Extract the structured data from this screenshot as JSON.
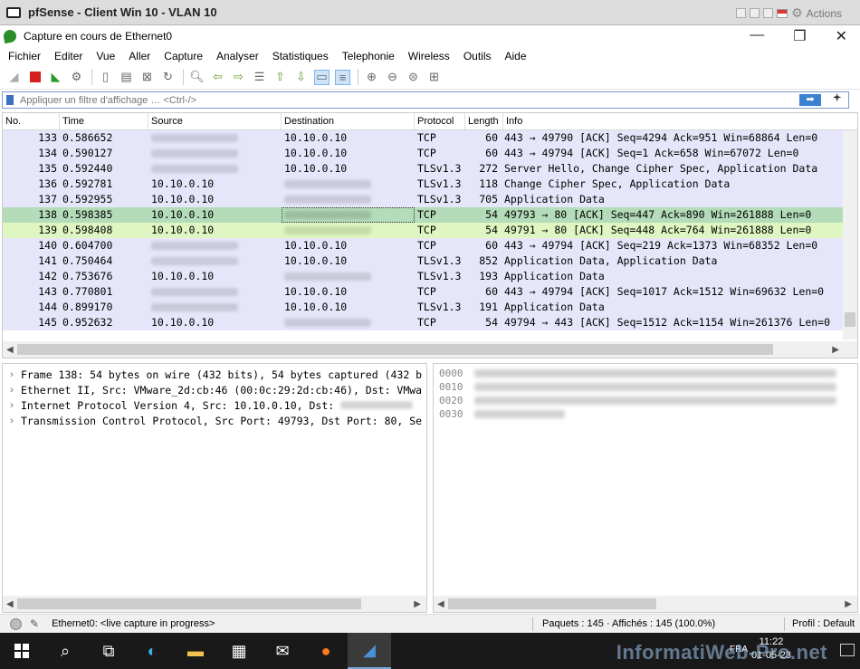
{
  "vm": {
    "title": "pfSense - Client Win 10 - VLAN 10",
    "actions_label": "Actions"
  },
  "window": {
    "title": "Capture en cours de Ethernet0"
  },
  "menu": [
    "Fichier",
    "Editer",
    "Vue",
    "Aller",
    "Capture",
    "Analyser",
    "Statistiques",
    "Telephonie",
    "Wireless",
    "Outils",
    "Aide"
  ],
  "filter": {
    "placeholder": "Appliquer un filtre d'affichage … <Ctrl-/>",
    "apply_label": "➡",
    "add_label": "+"
  },
  "packet_list": {
    "columns": [
      "No.",
      "Time",
      "Source",
      "Destination",
      "Protocol",
      "Length",
      "Info"
    ],
    "rows": [
      {
        "no": "133",
        "time": "0.586652",
        "src": "",
        "dst": "10.10.0.10",
        "proto": "TCP",
        "len": "60",
        "info": "443 → 49790 [ACK] Seq=4294 Ack=951 Win=68864 Len=0"
      },
      {
        "no": "134",
        "time": "0.590127",
        "src": "",
        "dst": "10.10.0.10",
        "proto": "TCP",
        "len": "60",
        "info": "443 → 49794 [ACK] Seq=1 Ack=658 Win=67072 Len=0"
      },
      {
        "no": "135",
        "time": "0.592440",
        "src": "",
        "dst": "10.10.0.10",
        "proto": "TLSv1.3",
        "len": "272",
        "info": "Server Hello, Change Cipher Spec, Application Data"
      },
      {
        "no": "136",
        "time": "0.592781",
        "src": "10.10.0.10",
        "dst": "",
        "proto": "TLSv1.3",
        "len": "118",
        "info": "Change Cipher Spec, Application Data"
      },
      {
        "no": "137",
        "time": "0.592955",
        "src": "10.10.0.10",
        "dst": "",
        "proto": "TLSv1.3",
        "len": "705",
        "info": "Application Data"
      },
      {
        "no": "138",
        "time": "0.598385",
        "src": "10.10.0.10",
        "dst": "",
        "proto": "TCP",
        "len": "54",
        "info": "49793 → 80 [ACK] Seq=447 Ack=890 Win=261888 Len=0"
      },
      {
        "no": "139",
        "time": "0.598408",
        "src": "10.10.0.10",
        "dst": "",
        "proto": "TCP",
        "len": "54",
        "info": "49791 → 80 [ACK] Seq=448 Ack=764 Win=261888 Len=0"
      },
      {
        "no": "140",
        "time": "0.604700",
        "src": "",
        "dst": "10.10.0.10",
        "proto": "TCP",
        "len": "60",
        "info": "443 → 49794 [ACK] Seq=219 Ack=1373 Win=68352 Len=0"
      },
      {
        "no": "141",
        "time": "0.750464",
        "src": "",
        "dst": "10.10.0.10",
        "proto": "TLSv1.3",
        "len": "852",
        "info": "Application Data, Application Data"
      },
      {
        "no": "142",
        "time": "0.753676",
        "src": "10.10.0.10",
        "dst": "",
        "proto": "TLSv1.3",
        "len": "193",
        "info": "Application Data"
      },
      {
        "no": "143",
        "time": "0.770801",
        "src": "",
        "dst": "10.10.0.10",
        "proto": "TCP",
        "len": "60",
        "info": "443 → 49794 [ACK] Seq=1017 Ack=1512 Win=69632 Len=0"
      },
      {
        "no": "144",
        "time": "0.899170",
        "src": "",
        "dst": "10.10.0.10",
        "proto": "TLSv1.3",
        "len": "191",
        "info": "Application Data"
      },
      {
        "no": "145",
        "time": "0.952632",
        "src": "10.10.0.10",
        "dst": "",
        "proto": "TCP",
        "len": "54",
        "info": "49794 → 443 [ACK] Seq=1512 Ack=1154 Win=261376 Len=0"
      }
    ]
  },
  "details": [
    "Frame 138: 54 bytes on wire (432 bits), 54 bytes captured (432 b",
    "Ethernet II, Src: VMware_2d:cb:46 (00:0c:29:2d:cb:46), Dst: VMwa",
    "Internet Protocol Version 4, Src: 10.10.0.10, Dst: ",
    "Transmission Control Protocol, Src Port: 49793, Dst Port: 80, Se"
  ],
  "hex_offsets": [
    "0000",
    "0010",
    "0020",
    "0030"
  ],
  "status": {
    "interface": "Ethernet0: <live capture in progress>",
    "packets": "Paquets : 145 · Affichés : 145 (100.0%)",
    "profile": "Profil : Default"
  },
  "taskbar": {
    "time": "11:22",
    "date": "01-05-23",
    "lang": "FRA",
    "watermark": "InformatiWeb-Pro.net"
  },
  "colors": {
    "row_default": "#e6e6fa",
    "row_selected": "#b4dcb9",
    "row_highlight": "#e0f6c2",
    "accent": "#3a82d0"
  }
}
